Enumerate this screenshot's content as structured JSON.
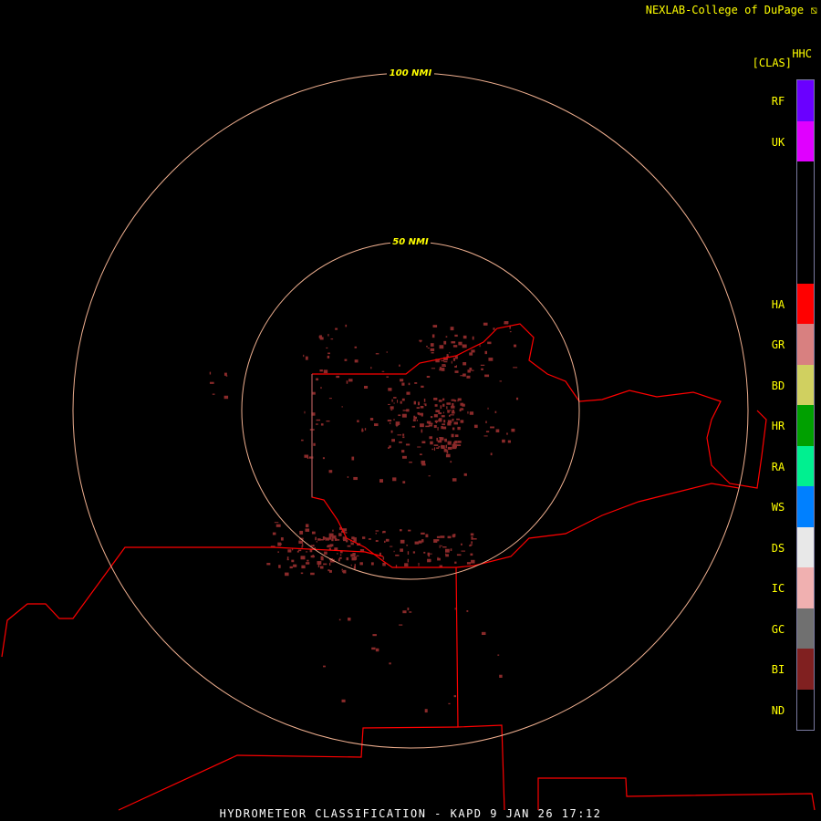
{
  "credit": "NEXLAB-College of DuPage",
  "credit_icon": "nexlab-logo-icon",
  "product": "HHC",
  "product_units": "[CLAS]",
  "title": "HYDROMETEOR CLASSIFICATION - KAPD 9 JAN 26 17:12",
  "range_rings": [
    {
      "label": "50 NMI"
    },
    {
      "label": "100 NMI"
    }
  ],
  "ring_color": "#f0b090",
  "border_color": "#ff0000",
  "legend": [
    {
      "code": "RF",
      "color": "#6a00ff"
    },
    {
      "code": "UK",
      "color": "#e000ff"
    },
    {
      "code": "",
      "color": "#000000"
    },
    {
      "code": "",
      "color": "#000000"
    },
    {
      "code": "",
      "color": "#000000"
    },
    {
      "code": "HA",
      "color": "#ff0000"
    },
    {
      "code": "GR",
      "color": "#d88080"
    },
    {
      "code": "BD",
      "color": "#d0d060"
    },
    {
      "code": "HR",
      "color": "#00a000"
    },
    {
      "code": "RA",
      "color": "#00f090"
    },
    {
      "code": "WS",
      "color": "#0080ff"
    },
    {
      "code": "DS",
      "color": "#e8e8e8"
    },
    {
      "code": "IC",
      "color": "#f0b0b0"
    },
    {
      "code": "GC",
      "color": "#707070"
    },
    {
      "code": "BI",
      "color": "#802020"
    },
    {
      "code": "ND",
      "color": "#000000"
    }
  ]
}
